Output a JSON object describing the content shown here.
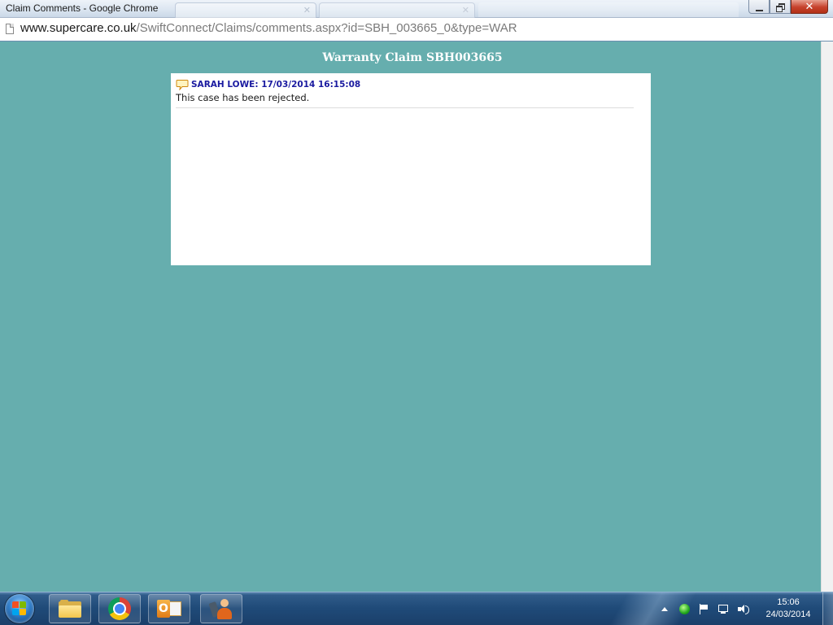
{
  "window": {
    "title": "Claim Comments - Google Chrome",
    "controls": {
      "minimize_icon": "minimize-icon",
      "restore_icon": "restore-icon",
      "close_icon": "close-icon",
      "close_glyph": "✕"
    }
  },
  "address_bar": {
    "icon": "page-icon",
    "url_host": "www.supercare.co.uk",
    "url_path": "/SwiftConnect/Claims/comments.aspx?id=SBH_003665_0&type=WAR"
  },
  "page": {
    "background_color": "#66aeae",
    "heading": "Warranty Claim SBH003665",
    "comments": [
      {
        "icon": "speech-bubble-icon",
        "author_line": "SARAH LOWE: 17/03/2014 16:15:08",
        "text": "This case has been rejected."
      }
    ]
  },
  "taskbar": {
    "start_icon": "windows-start-icon",
    "pinned": [
      {
        "name": "windows-explorer",
        "icon": "folder-icon"
      },
      {
        "name": "google-chrome",
        "icon": "chrome-icon"
      },
      {
        "name": "microsoft-outlook",
        "icon": "outlook-icon",
        "letter": "O"
      },
      {
        "name": "contacts-app",
        "icon": "person-phone-icon"
      }
    ],
    "tray": {
      "icons": [
        "show-hidden-icons-arrow",
        "status-green-icon",
        "action-center-flag-icon",
        "network-icon",
        "volume-icon"
      ]
    },
    "clock": {
      "time": "15:06",
      "date": "24/03/2014"
    }
  },
  "colors": {
    "page_bg": "#66aeae",
    "comment_author": "#1a1aa0",
    "taskbar": "#1f4a78"
  }
}
